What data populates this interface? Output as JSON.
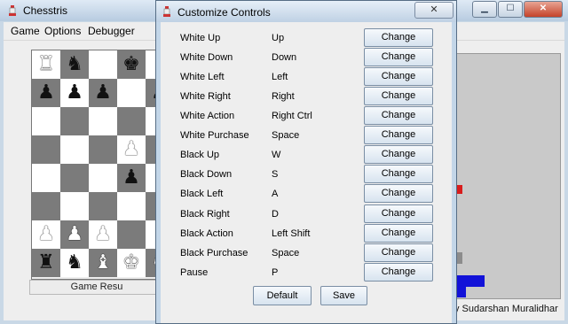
{
  "main_window": {
    "title": "Chesstris",
    "menu": [
      "Game",
      "Options",
      "Debugger"
    ],
    "game_result_label": "Game Resu",
    "author_text": "y Sudarshan Muralidhar"
  },
  "board": {
    "rows": [
      [
        "wR",
        "bN",
        "",
        "bK",
        "bB"
      ],
      [
        "bP",
        "bP",
        "bP",
        "",
        "bP"
      ],
      [
        "",
        "",
        "",
        "",
        ""
      ],
      [
        "",
        "",
        "",
        "wP",
        ""
      ],
      [
        "",
        "",
        "",
        "bP",
        ""
      ],
      [
        "",
        "",
        "",
        "",
        ""
      ],
      [
        "wP",
        "wP",
        "wP",
        "",
        ""
      ],
      [
        "bR",
        "bN",
        "wB",
        "wK",
        "wN"
      ]
    ]
  },
  "dialog": {
    "title": "Customize Controls",
    "close_label": "✕",
    "controls": [
      {
        "action": "White Up",
        "key": "Up"
      },
      {
        "action": "White Down",
        "key": "Down"
      },
      {
        "action": "White Left",
        "key": "Left"
      },
      {
        "action": "White Right",
        "key": "Right"
      },
      {
        "action": "White Action",
        "key": "Right Ctrl"
      },
      {
        "action": "White Purchase",
        "key": "Space"
      },
      {
        "action": "Black Up",
        "key": "W"
      },
      {
        "action": "Black Down",
        "key": "S"
      },
      {
        "action": "Black Left",
        "key": "A"
      },
      {
        "action": "Black Right",
        "key": "D"
      },
      {
        "action": "Black Action",
        "key": "Left Shift"
      },
      {
        "action": "Black Purchase",
        "key": "Space"
      },
      {
        "action": "Pause",
        "key": "P"
      }
    ],
    "change_label": "Change",
    "default_label": "Default",
    "save_label": "Save"
  },
  "colors": {
    "tetris_red": "#d81c1c",
    "tetris_blue": "#1212d8",
    "tetris_gray": "#8c8c8c"
  }
}
